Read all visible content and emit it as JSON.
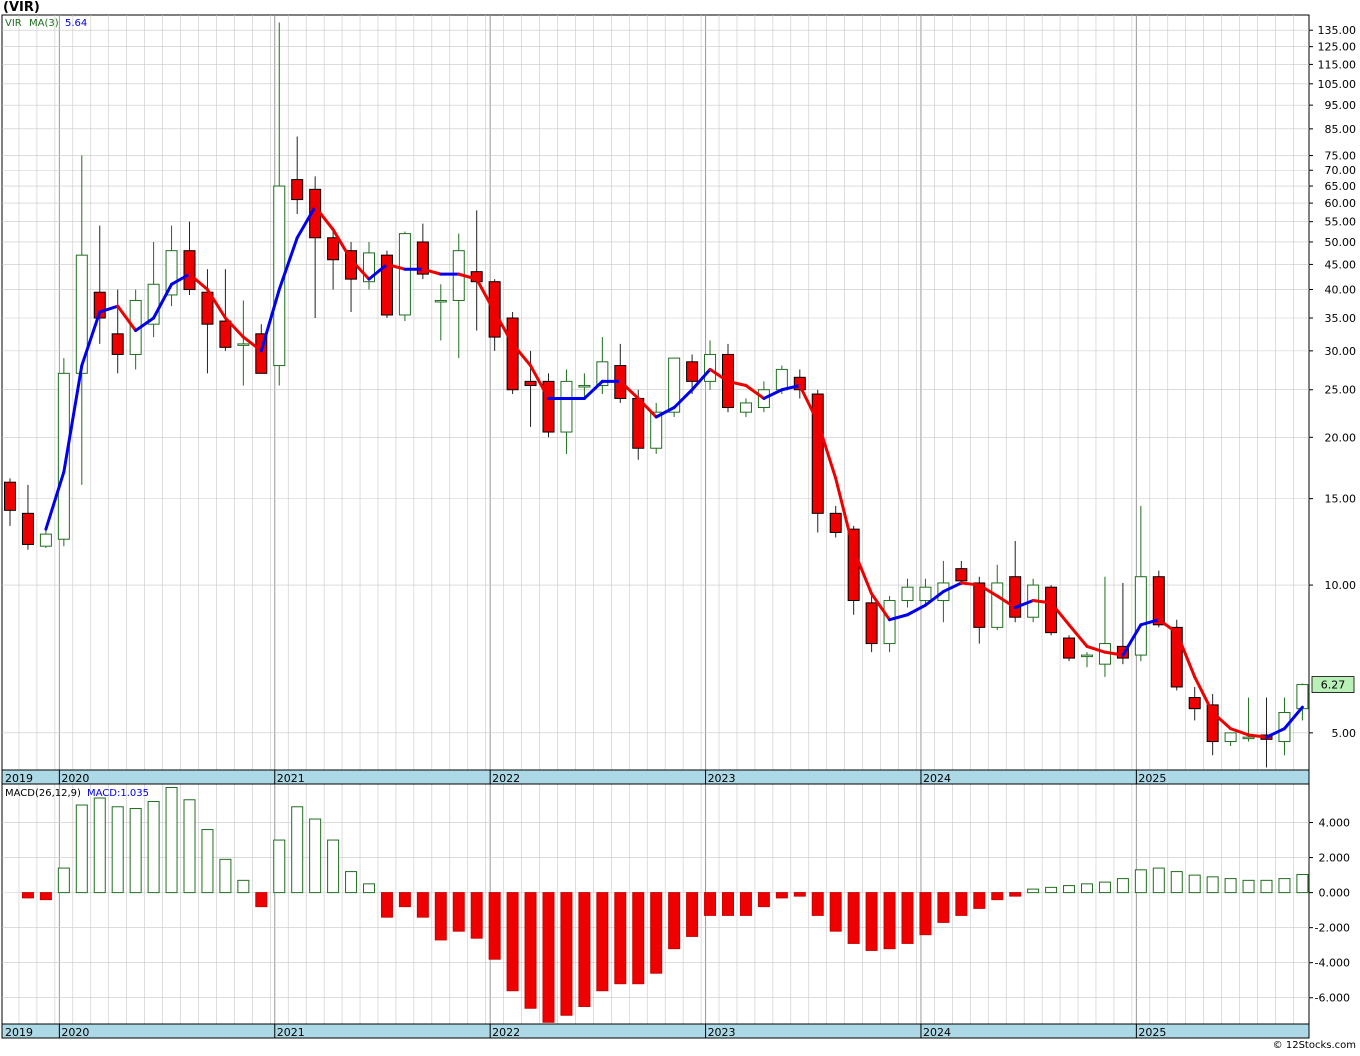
{
  "page_title": "(VIR)",
  "copyright": "© 12Stocks.com",
  "colors": {
    "up_candle_stroke": "#1f6e1f",
    "down_candle_fill": "#ee0000",
    "ma_up": "#0000ee",
    "ma_down": "#ee0000",
    "axis_band": "#add8e6",
    "grid": "#c8c8c8",
    "last_price_label": "#b8f0b8"
  },
  "chart_data": [
    {
      "type": "candlestick",
      "panel": "price",
      "legend": {
        "symbol": "VIR",
        "ma_label": "MA(3)",
        "ma_value": "5.64"
      },
      "scale": "log",
      "ylim": [
        4.2,
        145
      ],
      "y_ticks": [
        135,
        125,
        115,
        105,
        95,
        85,
        75,
        70,
        65,
        60,
        55,
        50,
        45,
        40,
        35,
        30,
        25,
        20,
        15,
        10,
        5
      ],
      "y_tick_labels": [
        "135.00",
        "125.00",
        "115.00",
        "105.00",
        "95.00",
        "85.00",
        "75.00",
        "70.00",
        "65.00",
        "60.00",
        "55.00",
        "50.00",
        "45.00",
        "40.00",
        "35.00",
        "30.00",
        "25.00",
        "20.00",
        "15.00",
        "10.00",
        "5.00"
      ],
      "x_labels": [
        "2019",
        "2020",
        "2021",
        "2022",
        "2023",
        "2024",
        "2025"
      ],
      "last_price_label": "6.27",
      "candles": [
        {
          "o": 16.2,
          "h": 16.5,
          "l": 13.2,
          "c": 14.2
        },
        {
          "o": 14.0,
          "h": 16.0,
          "l": 11.8,
          "c": 12.1
        },
        {
          "o": 12.0,
          "h": 13.0,
          "l": 11.9,
          "c": 12.7
        },
        {
          "o": 12.4,
          "h": 29.0,
          "l": 12.0,
          "c": 27.0
        },
        {
          "o": 27.0,
          "h": 75.0,
          "l": 16.0,
          "c": 47.0
        },
        {
          "o": 39.5,
          "h": 54.0,
          "l": 31.0,
          "c": 35.0
        },
        {
          "o": 32.5,
          "h": 40.0,
          "l": 27.0,
          "c": 29.5
        },
        {
          "o": 29.5,
          "h": 40.0,
          "l": 27.5,
          "c": 38.0
        },
        {
          "o": 34.0,
          "h": 50.0,
          "l": 32.0,
          "c": 41.0
        },
        {
          "o": 39.0,
          "h": 54.0,
          "l": 37.0,
          "c": 48.0
        },
        {
          "o": 48.0,
          "h": 55.0,
          "l": 39.0,
          "c": 40.0
        },
        {
          "o": 39.5,
          "h": 44.0,
          "l": 27.0,
          "c": 34.0
        },
        {
          "o": 34.5,
          "h": 44.0,
          "l": 30.0,
          "c": 30.5
        },
        {
          "o": 31.0,
          "h": 38.0,
          "l": 25.5,
          "c": 31.0
        },
        {
          "o": 32.5,
          "h": 34.0,
          "l": 27.0,
          "c": 27.0
        },
        {
          "o": 28.0,
          "h": 140.0,
          "l": 25.5,
          "c": 65.0
        },
        {
          "o": 67.0,
          "h": 82.0,
          "l": 57.0,
          "c": 61.0
        },
        {
          "o": 64.0,
          "h": 68.0,
          "l": 35.0,
          "c": 51.0
        },
        {
          "o": 51.0,
          "h": 53.0,
          "l": 40.0,
          "c": 46.0
        },
        {
          "o": 48.0,
          "h": 50.0,
          "l": 36.0,
          "c": 42.0
        },
        {
          "o": 41.5,
          "h": 50.0,
          "l": 40.0,
          "c": 47.5
        },
        {
          "o": 47.0,
          "h": 48.0,
          "l": 35.0,
          "c": 35.5
        },
        {
          "o": 35.5,
          "h": 52.5,
          "l": 34.5,
          "c": 52.0
        },
        {
          "o": 50.0,
          "h": 54.5,
          "l": 42.0,
          "c": 43.0
        },
        {
          "o": 38.0,
          "h": 41.0,
          "l": 31.5,
          "c": 38.0
        },
        {
          "o": 38.0,
          "h": 52.0,
          "l": 29.0,
          "c": 48.0
        },
        {
          "o": 43.5,
          "h": 58.0,
          "l": 33.0,
          "c": 41.5
        },
        {
          "o": 41.5,
          "h": 42.0,
          "l": 30.0,
          "c": 32.0
        },
        {
          "o": 35.0,
          "h": 36.0,
          "l": 24.5,
          "c": 25.0
        },
        {
          "o": 26.0,
          "h": 30.0,
          "l": 21.0,
          "c": 25.5
        },
        {
          "o": 26.0,
          "h": 27.0,
          "l": 20.0,
          "c": 20.5
        },
        {
          "o": 20.5,
          "h": 27.5,
          "l": 18.5,
          "c": 26.0
        },
        {
          "o": 25.5,
          "h": 27.0,
          "l": 24.0,
          "c": 25.5
        },
        {
          "o": 25.5,
          "h": 32.0,
          "l": 24.5,
          "c": 28.5
        },
        {
          "o": 28.0,
          "h": 31.0,
          "l": 23.5,
          "c": 24.0
        },
        {
          "o": 24.0,
          "h": 25.0,
          "l": 18.0,
          "c": 19.0
        },
        {
          "o": 19.0,
          "h": 23.5,
          "l": 18.5,
          "c": 22.5
        },
        {
          "o": 22.5,
          "h": 29.0,
          "l": 22.0,
          "c": 29.0
        },
        {
          "o": 28.5,
          "h": 29.5,
          "l": 24.5,
          "c": 26.0
        },
        {
          "o": 26.0,
          "h": 31.5,
          "l": 25.0,
          "c": 29.5
        },
        {
          "o": 29.5,
          "h": 31.0,
          "l": 22.5,
          "c": 23.0
        },
        {
          "o": 22.5,
          "h": 24.0,
          "l": 22.0,
          "c": 23.5
        },
        {
          "o": 23.0,
          "h": 26.0,
          "l": 22.5,
          "c": 25.0
        },
        {
          "o": 25.0,
          "h": 28.0,
          "l": 24.5,
          "c": 27.5
        },
        {
          "o": 26.5,
          "h": 27.5,
          "l": 24.0,
          "c": 25.0
        },
        {
          "o": 24.5,
          "h": 25.0,
          "l": 12.8,
          "c": 14.0
        },
        {
          "o": 14.0,
          "h": 14.5,
          "l": 12.5,
          "c": 12.8
        },
        {
          "o": 13.0,
          "h": 13.2,
          "l": 8.7,
          "c": 9.3
        },
        {
          "o": 9.2,
          "h": 9.5,
          "l": 7.3,
          "c": 7.6
        },
        {
          "o": 7.6,
          "h": 9.5,
          "l": 7.3,
          "c": 9.3
        },
        {
          "o": 9.3,
          "h": 10.3,
          "l": 9.0,
          "c": 9.9
        },
        {
          "o": 9.3,
          "h": 10.3,
          "l": 9.1,
          "c": 9.9
        },
        {
          "o": 9.3,
          "h": 11.2,
          "l": 8.4,
          "c": 10.1
        },
        {
          "o": 10.8,
          "h": 11.2,
          "l": 10.0,
          "c": 10.2
        },
        {
          "o": 10.1,
          "h": 10.4,
          "l": 7.6,
          "c": 8.2
        },
        {
          "o": 8.2,
          "h": 11.0,
          "l": 8.1,
          "c": 10.1
        },
        {
          "o": 10.4,
          "h": 12.3,
          "l": 8.4,
          "c": 8.6
        },
        {
          "o": 8.6,
          "h": 10.3,
          "l": 8.4,
          "c": 10.0
        },
        {
          "o": 9.9,
          "h": 10.0,
          "l": 7.9,
          "c": 8.0
        },
        {
          "o": 7.8,
          "h": 7.9,
          "l": 7.0,
          "c": 7.1
        },
        {
          "o": 7.2,
          "h": 7.3,
          "l": 6.8,
          "c": 7.2
        },
        {
          "o": 6.9,
          "h": 10.4,
          "l": 6.5,
          "c": 7.6
        },
        {
          "o": 7.5,
          "h": 10.1,
          "l": 6.9,
          "c": 7.1
        },
        {
          "o": 7.2,
          "h": 14.5,
          "l": 7.0,
          "c": 10.4
        },
        {
          "o": 10.4,
          "h": 10.7,
          "l": 8.2,
          "c": 8.3
        },
        {
          "o": 8.2,
          "h": 8.5,
          "l": 6.1,
          "c": 6.2
        },
        {
          "o": 5.9,
          "h": 6.2,
          "l": 5.3,
          "c": 5.6
        },
        {
          "o": 5.7,
          "h": 6.0,
          "l": 4.5,
          "c": 4.8
        },
        {
          "o": 4.8,
          "h": 5.0,
          "l": 4.7,
          "c": 5.0
        },
        {
          "o": 4.9,
          "h": 5.9,
          "l": 4.8,
          "c": 4.9
        },
        {
          "o": 4.95,
          "h": 5.9,
          "l": 4.25,
          "c": 4.85
        },
        {
          "o": 4.8,
          "h": 5.9,
          "l": 4.5,
          "c": 5.5
        },
        {
          "o": 5.6,
          "h": 6.3,
          "l": 5.3,
          "c": 6.27
        }
      ],
      "ma": [
        null,
        null,
        13.0,
        17.0,
        28.0,
        36.0,
        37.0,
        33.0,
        35.0,
        41.0,
        43.0,
        40.0,
        35.0,
        32.0,
        30.0,
        40.0,
        51.0,
        59.0,
        53.0,
        46.0,
        42.0,
        45.0,
        44.0,
        44.0,
        43.0,
        43.0,
        42.0,
        36.0,
        31.0,
        28.0,
        24.0,
        24.0,
        24.0,
        26.0,
        26.0,
        24.0,
        22.0,
        23.0,
        25.0,
        27.5,
        26.0,
        25.5,
        24.0,
        25.0,
        25.5,
        21.5,
        16.5,
        11.8,
        9.6,
        8.5,
        8.7,
        9.1,
        9.7,
        10.1,
        10.0,
        9.5,
        9.0,
        9.3,
        9.2,
        8.3,
        7.5,
        7.3,
        7.2,
        8.3,
        8.5,
        8.0,
        6.5,
        5.5,
        5.1,
        4.95,
        4.9,
        5.1,
        5.64
      ]
    },
    {
      "type": "bar",
      "panel": "macd",
      "legend": {
        "label": "MACD(26,12,9)",
        "value_label": "MACD:1.035"
      },
      "ylim": [
        -7.5,
        6.2
      ],
      "y_ticks": [
        4,
        2,
        0,
        -2,
        -4,
        -6
      ],
      "y_tick_labels": [
        "4.000",
        "2.000",
        "0.000",
        "-2.000",
        "-4.000",
        "-6.000"
      ],
      "x_labels": [
        "2019",
        "2020",
        "2021",
        "2022",
        "2023",
        "2024",
        "2025"
      ],
      "values": [
        0.0,
        -0.3,
        -0.4,
        1.4,
        5.0,
        5.4,
        4.9,
        4.8,
        5.2,
        6.0,
        5.3,
        3.6,
        1.9,
        0.7,
        -0.8,
        3.0,
        4.9,
        4.2,
        3.0,
        1.2,
        0.5,
        -1.4,
        -0.8,
        -1.4,
        -2.7,
        -2.2,
        -2.6,
        -3.8,
        -5.6,
        -6.6,
        -7.4,
        -7.0,
        -6.5,
        -5.6,
        -5.2,
        -5.2,
        -4.6,
        -3.2,
        -2.5,
        -1.3,
        -1.3,
        -1.3,
        -0.8,
        -0.3,
        -0.2,
        -1.3,
        -2.2,
        -2.9,
        -3.3,
        -3.2,
        -2.9,
        -2.4,
        -1.7,
        -1.3,
        -0.9,
        -0.4,
        -0.2,
        0.2,
        0.3,
        0.4,
        0.5,
        0.6,
        0.8,
        1.3,
        1.4,
        1.2,
        1.0,
        0.9,
        0.8,
        0.7,
        0.7,
        0.8,
        1.035
      ]
    }
  ]
}
